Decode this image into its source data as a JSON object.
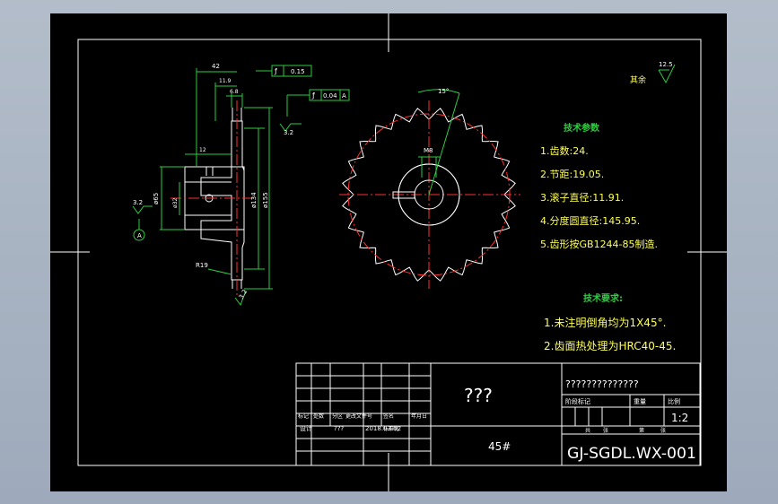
{
  "surface": {
    "roughness": "12.5",
    "roughness_label": "其余"
  },
  "tech_params": {
    "title": "技术参数",
    "items": [
      "1.齿数:24.",
      "2.节距:19.05.",
      "3.滚子直径:11.91.",
      "4.分度圆直径:145.95.",
      "5.齿形按GB1244-85制造."
    ]
  },
  "tech_req": {
    "title": "技术要求:",
    "items": [
      "1.未注明倒角均为1X45°.",
      "2.齿面热处理为HRC40-45."
    ]
  },
  "dims": {
    "d42": "42",
    "d119": "11.9",
    "d68": "6.8",
    "d12": "12",
    "d65": "ø65",
    "d32": "ø32",
    "d134": "ø134",
    "d155": "ø155",
    "r19": "R19",
    "m8": "M8",
    "ang": "15°",
    "tol1": "0.15",
    "tol2": "0.04",
    "datum": "A",
    "rough32": "3.2"
  },
  "title_block": {
    "part_name": "???",
    "material": "45#",
    "drawing_no": "GJ-SGDL.WX-001",
    "company": "??????????????",
    "scale": "1:2",
    "date": "2018.03.02",
    "designer": "???",
    "row_labels": [
      "标记",
      "处数",
      "分区",
      "更改文件号",
      "签名",
      "年月日"
    ],
    "sign_labels": [
      "设计",
      "标准化"
    ],
    "stage_label": "阶段标记",
    "weight_label": "重量",
    "scale_label": "比例",
    "sheet_labels": [
      "共",
      "张",
      "第",
      "张"
    ]
  }
}
